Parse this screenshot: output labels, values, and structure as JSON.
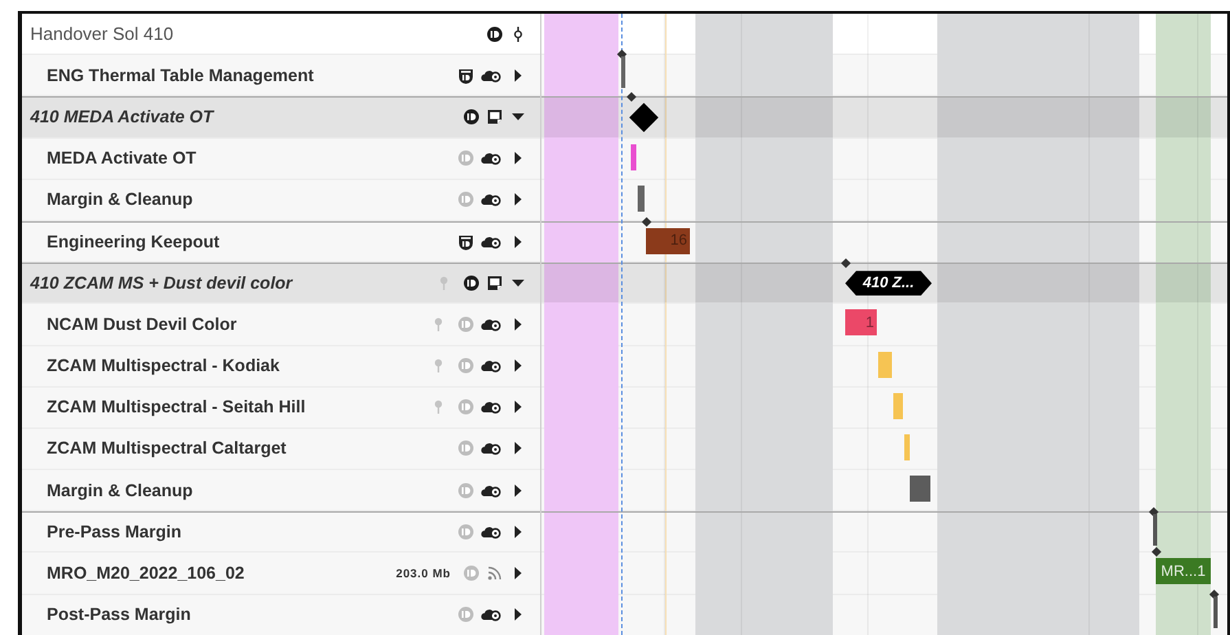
{
  "header": {
    "label": "Handover Sol 410",
    "icons": [
      {
        "kind": "id",
        "dimmed": false
      },
      {
        "kind": "branch"
      }
    ]
  },
  "rows": [
    {
      "label": "ENG Thermal Table Management",
      "kind": "item",
      "icons": [
        {
          "kind": "shield-id"
        },
        {
          "kind": "cloud"
        }
      ],
      "expanded": false,
      "mark": {
        "kind": "tick",
        "anchor": true,
        "color": "#666666"
      }
    },
    {
      "label": "410 MEDA Activate OT",
      "kind": "group",
      "icons": [
        {
          "kind": "id",
          "dimmed": false
        },
        {
          "kind": "note"
        }
      ],
      "expanded": true,
      "mark": {
        "kind": "diamond",
        "anchor": true,
        "color": "#000000"
      },
      "children": [
        {
          "label": "MEDA Activate OT",
          "kind": "item",
          "icons": [
            {
              "kind": "id",
              "dimmed": true
            },
            {
              "kind": "cloud"
            }
          ],
          "expanded": false,
          "mark": {
            "kind": "block",
            "anchor": false,
            "color": "#e94fd0"
          }
        },
        {
          "label": "Margin & Cleanup",
          "kind": "item",
          "icons": [
            {
              "kind": "id",
              "dimmed": true
            },
            {
              "kind": "cloud"
            }
          ],
          "expanded": false,
          "mark": {
            "kind": "block",
            "anchor": false,
            "color": "#666666"
          }
        }
      ]
    },
    {
      "label": "Engineering Keepout",
      "kind": "item",
      "icons": [
        {
          "kind": "shield-id"
        },
        {
          "kind": "cloud"
        }
      ],
      "expanded": false,
      "mark": {
        "kind": "block",
        "anchor": true,
        "color": "#8b3a1b",
        "label": "16",
        "label_inverted": false
      }
    },
    {
      "label": "410 ZCAM MS + Dust devil color",
      "kind": "group",
      "icons": [
        {
          "kind": "pin"
        },
        {
          "kind": "id",
          "dimmed": false
        },
        {
          "kind": "note"
        }
      ],
      "expanded": true,
      "mark": {
        "kind": "flag",
        "anchor": true,
        "color": "#000000",
        "label": "410 Z..."
      },
      "children": [
        {
          "label": "NCAM Dust Devil Color",
          "kind": "item",
          "icons": [
            {
              "kind": "pin"
            },
            {
              "kind": "id",
              "dimmed": true
            },
            {
              "kind": "cloud"
            }
          ],
          "expanded": false,
          "mark": {
            "kind": "block",
            "anchor": false,
            "color": "#eb4868",
            "label": "1",
            "label_inverted": false
          }
        },
        {
          "label": "ZCAM Multispectral - Kodiak",
          "kind": "item",
          "icons": [
            {
              "kind": "pin"
            },
            {
              "kind": "id",
              "dimmed": true
            },
            {
              "kind": "cloud"
            }
          ],
          "expanded": false,
          "mark": {
            "kind": "block",
            "anchor": false,
            "color": "#f6c453"
          }
        },
        {
          "label": "ZCAM Multispectral - Seitah Hill",
          "kind": "item",
          "icons": [
            {
              "kind": "pin"
            },
            {
              "kind": "id",
              "dimmed": true
            },
            {
              "kind": "cloud"
            }
          ],
          "expanded": false,
          "mark": {
            "kind": "block",
            "anchor": false,
            "color": "#f6c453"
          }
        },
        {
          "label": "ZCAM Multispectral Caltarget",
          "kind": "item",
          "icons": [
            {
              "kind": "id",
              "dimmed": true
            },
            {
              "kind": "cloud"
            }
          ],
          "expanded": false,
          "mark": {
            "kind": "block",
            "anchor": false,
            "color": "#f6c453"
          }
        },
        {
          "label": "Margin & Cleanup",
          "kind": "item",
          "icons": [
            {
              "kind": "id",
              "dimmed": true
            },
            {
              "kind": "cloud"
            }
          ],
          "expanded": false,
          "mark": {
            "kind": "block",
            "anchor": false,
            "color": "#5c5c5c"
          }
        }
      ]
    },
    {
      "label": "Pre-Pass Margin",
      "kind": "item",
      "icons": [
        {
          "kind": "id",
          "dimmed": true
        },
        {
          "kind": "cloud"
        }
      ],
      "expanded": false,
      "mark": {
        "kind": "tick",
        "anchor": true,
        "color": "#555555"
      }
    },
    {
      "label": "MRO_M20_2022_106_02",
      "kind": "item",
      "size": "203.0 Mb",
      "icons": [
        {
          "kind": "id",
          "dimmed": true
        },
        {
          "kind": "feed"
        }
      ],
      "expanded": false,
      "mark": {
        "kind": "block",
        "anchor": true,
        "color": "#3b7a23",
        "label": "MR...1",
        "label_inverted": true
      }
    },
    {
      "label": "Post-Pass Margin",
      "kind": "item",
      "icons": [
        {
          "kind": "id",
          "dimmed": true
        },
        {
          "kind": "cloud"
        }
      ],
      "expanded": false,
      "mark": {
        "kind": "tick",
        "anchor": true,
        "color": "#555555"
      }
    }
  ]
}
